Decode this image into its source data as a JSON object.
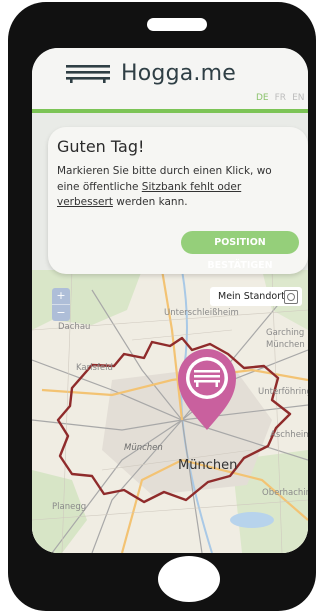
{
  "app": {
    "logo_text": "Hogga.me",
    "languages": [
      {
        "label": "DE",
        "active": true
      },
      {
        "label": "FR",
        "active": false
      },
      {
        "label": "EN",
        "active": false
      }
    ]
  },
  "card": {
    "title": "Guten Tag!",
    "text_before": "Markieren Sie bitte durch einen Klick, wo eine öffentliche ",
    "link_text": "Sitzbank fehlt oder verbessert",
    "text_after": " werden kann.",
    "confirm_label": "POSITION BESTÄTIGEN"
  },
  "map": {
    "zoom_in_label": "+",
    "zoom_out_label": "−",
    "my_location_label": "Mein Standort",
    "marker_icon": "bench-icon",
    "places": {
      "unterschleissheim": "Unterschleißheim",
      "dachau": "Dachau",
      "garching": "Garching",
      "garching_nord": "München",
      "karlsfeld": "Karlsfeld",
      "unterfoehring": "Unterföhring",
      "aschheim": "Aschheim",
      "munich_italic": "München",
      "munich": "München",
      "planegg": "Planegg",
      "oberhaching": "Oberhaching"
    }
  },
  "colors": {
    "accent_green": "#7cc456",
    "button_green": "#95cf7a",
    "marker_pink": "#c9609e",
    "boundary_red": "#8f2b2b"
  }
}
